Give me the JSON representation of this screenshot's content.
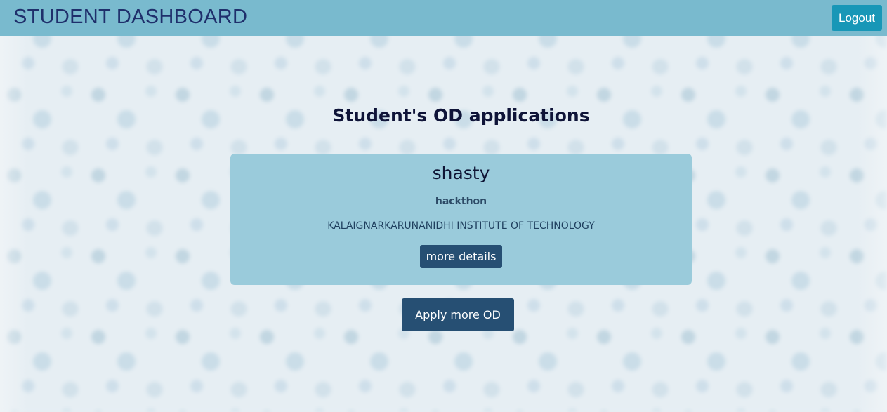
{
  "header": {
    "title": "STUDENT DASHBOARD",
    "logout_label": "Logout"
  },
  "main": {
    "section_title": "Student's OD applications",
    "applications": [
      {
        "name": "shasty",
        "event": "hackthon",
        "college": "KALAIGNARKARUNANIDHI INSTITUTE OF TECHNOLOGY",
        "details_label": "more details"
      }
    ],
    "apply_label": "Apply more OD"
  },
  "colors": {
    "header_bg": "#79bace",
    "title_text": "#1f2f6b",
    "logout_bg": "#1897b7",
    "card_bg": "#9acbdb",
    "button_bg": "#264f73"
  }
}
